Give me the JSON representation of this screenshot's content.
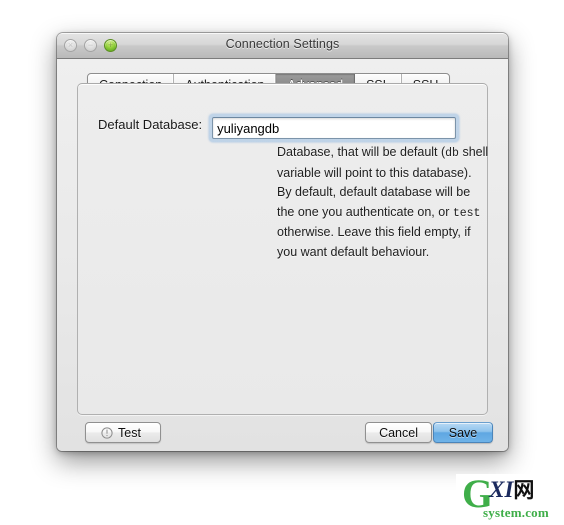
{
  "window": {
    "title": "Connection Settings",
    "traffic_lights": [
      {
        "name": "close",
        "state": "disabled",
        "glyph": "×"
      },
      {
        "name": "minimize",
        "state": "disabled",
        "glyph": "−"
      },
      {
        "name": "zoom",
        "state": "active",
        "glyph": "+"
      }
    ]
  },
  "tabs": [
    {
      "label": "Connection",
      "selected": false
    },
    {
      "label": "Authentication",
      "selected": false
    },
    {
      "label": "Advanced",
      "selected": true
    },
    {
      "label": "SSL",
      "selected": false
    },
    {
      "label": "SSH",
      "selected": false
    }
  ],
  "form": {
    "default_database_label": "Default Database:",
    "default_database_value": "yuliyangdb",
    "default_database_placeholder": "",
    "description_parts": [
      {
        "text": "Database, that will be default (",
        "mono": false
      },
      {
        "text": "db",
        "mono": true
      },
      {
        "text": " shell variable will point to this database). By default, default database will be the one you authenticate on, or ",
        "mono": false
      },
      {
        "text": "test",
        "mono": true
      },
      {
        "text": " otherwise. Leave this field empty, if you want default behaviour.",
        "mono": false
      }
    ]
  },
  "footer": {
    "test_label": "Test",
    "cancel_label": "Cancel",
    "save_label": "Save"
  },
  "watermark": {
    "letter_g": "G",
    "letters_xi": "XI",
    "char_cn": "网",
    "subtitle": "system.com"
  },
  "colors": {
    "accent_blue": "#5fa7e2",
    "selected_tab": "#8c8c8c",
    "focus_ring": "#7dafe1",
    "watermark_green": "#3fae49",
    "watermark_navy": "#1b2a5e",
    "window_chrome": "#ececec"
  }
}
